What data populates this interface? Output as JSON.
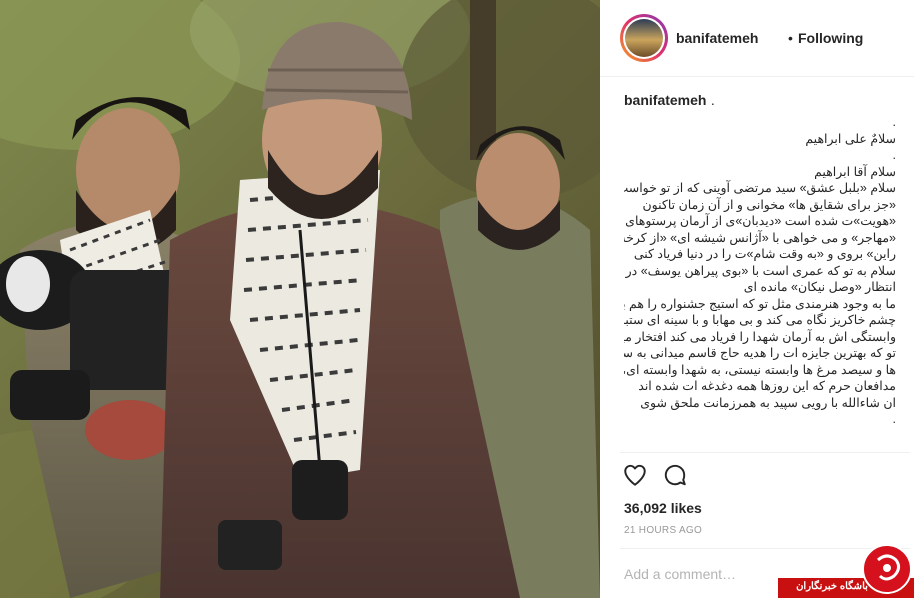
{
  "post": {
    "image_alt": "",
    "header": {
      "username": "banifatemeh",
      "separator": "•",
      "follow_status": "Following"
    },
    "caption": {
      "username": "banifatemeh",
      "suffix": ".",
      "lines": [
        ".",
        "سلامٌ علی ابراهیم",
        ".",
        "سلام آقا ابراهیم",
        "سلام «بلبل عشق» سید مرتضی آوینی که از تو خواست",
        "«جز برای شقایق ها» مخوانی و از آن زمان تاکنون",
        "«هویت»ت شده است «دیدبان»ی از آرمان پرستوهای",
        "«مهاجر» و می خواهی با «آژانس شیشه ای» «از کرخه تا",
        "راین» بروی و «به وقت شام»ت را در دنیا فریاد کنی",
        "سلام به تو که عمری است با «بوی پیراهن یوسف» در",
        "انتظار «وصل نیکان» مانده ای",
        "ما به وجود هنرمندی مثل تو که استیج جشنواره را هم به",
        "چشم خاکریز نگاه می کند و بی مهابا و با سینه ای ستبر",
        "وابستگی اش به آرمان شهدا را فریاد می کند افتخار میکنیم",
        "تو که بهترین جایزه ات را هدیه حاج قاسم میدانی به سیمرغ",
        "ها و سیصد مرغ ها وابسته نیستی، به شهدا وابسته ای، به",
        "مدافعان حرم که این روزها همه دغدغه ات شده اند",
        "ان شاءالله با رویی سپید به همرزمانت ملحق شوی",
        "."
      ]
    },
    "actions": {
      "like_icon": "heart-outline-icon",
      "comment_icon": "comment-bubble-icon"
    },
    "likes": "36,092 likes",
    "time_ago": "21 HOURS AGO",
    "add_comment_placeholder": "Add a comment…"
  },
  "watermark": {
    "text": "باشگاه خبرنگاران",
    "color": "#c81010"
  },
  "colors": {
    "text": "#262626",
    "muted": "#999999",
    "border": "#efefef"
  }
}
